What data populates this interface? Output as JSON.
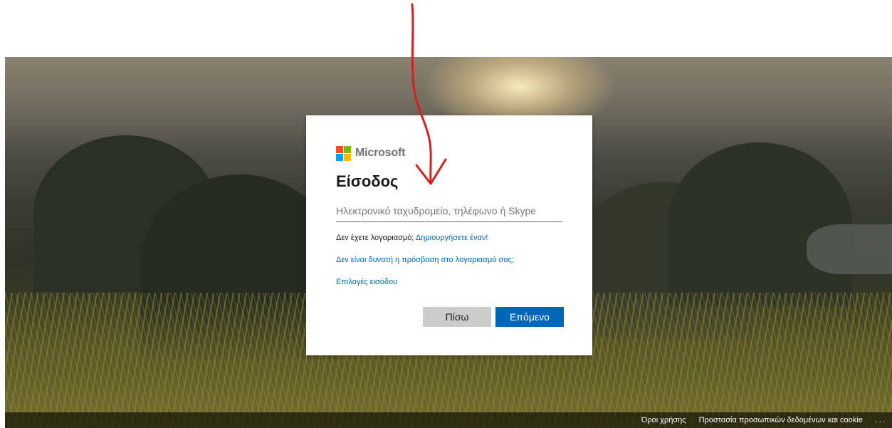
{
  "brand": {
    "name": "Microsoft",
    "colors": [
      "#f25022",
      "#7fba00",
      "#00a4ef",
      "#ffb900"
    ]
  },
  "signin": {
    "title": "Είσοδος",
    "input_placeholder": "Ηλεκτρονικό ταχυδρομείο, τηλέφωνο ή Skype",
    "input_value": "",
    "no_account_text": "Δεν έχετε λογαριασμό;",
    "create_link": "Δημιουργήσετε έναν!",
    "cant_access_link": "Δεν είναι δυνατή η πρόσβαση στο λογαριασμό σας;",
    "signin_options_link": "Επιλογές εισόδου",
    "back_button": "Πίσω",
    "next_button": "Επόμενο"
  },
  "footer": {
    "terms": "Όροι χρήσης",
    "privacy": "Προστασία προσωπικών δεδομένων και cookie",
    "more": "..."
  },
  "colors": {
    "accent": "#0067b8",
    "annotation": "#d61f1f"
  }
}
